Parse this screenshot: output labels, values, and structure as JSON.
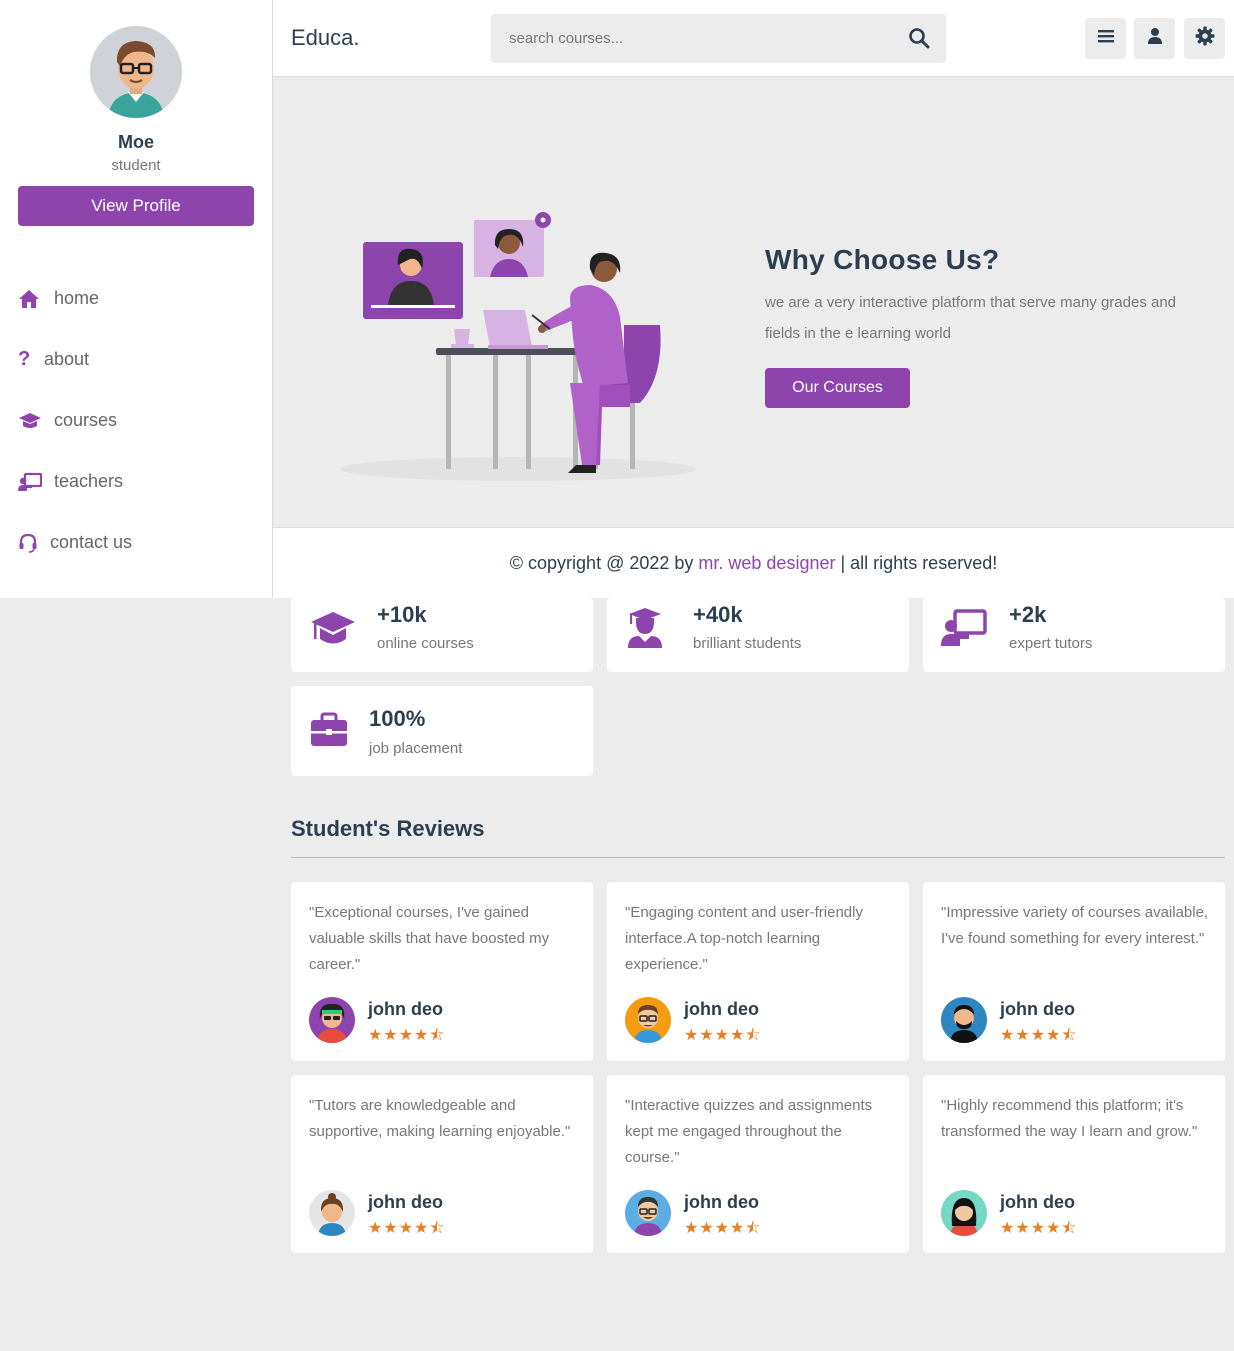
{
  "colors": {
    "accent": "#8e44ad",
    "star": "#e67e22",
    "text": "#2c3e50",
    "muted": "#777777"
  },
  "profile": {
    "name": "Moe",
    "role": "student",
    "button": "View Profile"
  },
  "sidebar": {
    "items": [
      {
        "label": "home",
        "icon": "home-icon"
      },
      {
        "label": "about",
        "icon": "question-icon"
      },
      {
        "label": "courses",
        "icon": "graduation-cap-icon"
      },
      {
        "label": "teachers",
        "icon": "chalkboard-teacher-icon"
      },
      {
        "label": "contact us",
        "icon": "headset-icon"
      }
    ]
  },
  "header": {
    "logo": "Educa.",
    "search_placeholder": "search courses...",
    "buttons": [
      "menu-icon",
      "user-icon",
      "gear-icon"
    ]
  },
  "hero": {
    "title": "Why Choose Us?",
    "text": "we are a very interactive platform that serve many grades and fields in the e learning world",
    "button": "Our Courses"
  },
  "footer": {
    "prefix": "© copyright @ 2022 by ",
    "link": "mr. web designer",
    "suffix": " | all rights reserved!"
  },
  "stats": [
    {
      "value": "+10k",
      "label": "online courses",
      "icon": "graduation-cap-icon"
    },
    {
      "value": "+40k",
      "label": "brilliant students",
      "icon": "student-icon"
    },
    {
      "value": "+2k",
      "label": "expert tutors",
      "icon": "chalkboard-teacher-icon"
    },
    {
      "value": "100%",
      "label": "job placement",
      "icon": "briefcase-icon"
    }
  ],
  "reviews": {
    "title": "Student's Reviews",
    "items": [
      {
        "quote": "\"Exceptional courses, I've gained valuable skills that have boosted my career.\"",
        "name": "john deo",
        "rating": 4.5
      },
      {
        "quote": "\"Engaging content and user-friendly interface.A top-notch learning experience.\"",
        "name": "john deo",
        "rating": 4.5
      },
      {
        "quote": "\"Impressive variety of courses available, I've found something for every interest.\"",
        "name": "john deo",
        "rating": 4.5
      },
      {
        "quote": "\"Tutors are knowledgeable and supportive, making learning enjoyable.\"",
        "name": "john deo",
        "rating": 4.5
      },
      {
        "quote": "\"Interactive quizzes and assignments kept me engaged throughout the course.\"",
        "name": "john deo",
        "rating": 4.5
      },
      {
        "quote": "\"Highly recommend this platform; it's transformed the way I learn and grow.\"",
        "name": "john deo",
        "rating": 4.5
      }
    ]
  }
}
